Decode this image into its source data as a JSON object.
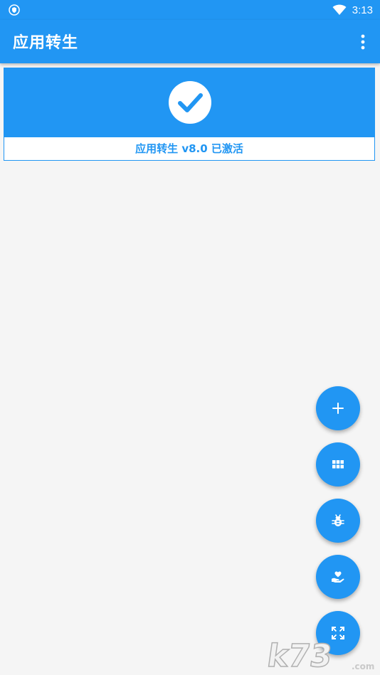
{
  "status_bar": {
    "time": "3:13"
  },
  "app_bar": {
    "title": "应用转生"
  },
  "activation_card": {
    "label": "应用转生 v8.0 已激活"
  },
  "fabs": [
    {
      "icon": "plus-icon"
    },
    {
      "icon": "grid-icon"
    },
    {
      "icon": "bug-icon"
    },
    {
      "icon": "heart-hand-icon"
    },
    {
      "icon": "expand-icon"
    }
  ],
  "watermark": {
    "text": "k73",
    "domain": ".com"
  },
  "colors": {
    "primary": "#2196f3",
    "background": "#f5f5f5"
  }
}
